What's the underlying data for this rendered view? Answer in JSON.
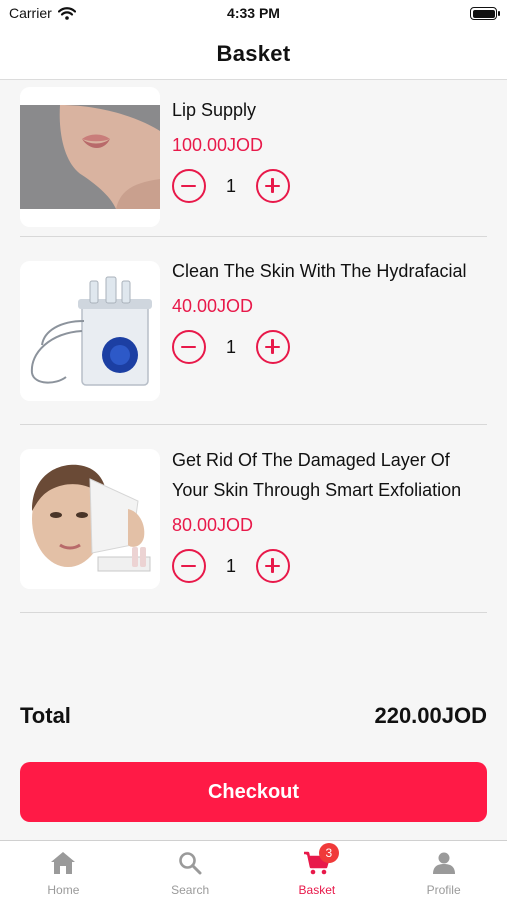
{
  "status_bar": {
    "carrier": "Carrier",
    "time": "4:33 PM"
  },
  "header": {
    "title": "Basket"
  },
  "items": [
    {
      "name": "Lip Supply",
      "price": "100.00JOD",
      "quantity": "1",
      "image_icon": "lips-photo"
    },
    {
      "name": "Clean The Skin With The Hydrafacial",
      "price": "40.00JOD",
      "quantity": "1",
      "image_icon": "hydrafacial-machine-photo"
    },
    {
      "name": "Get Rid Of The Damaged Layer Of Your Skin Through Smart Exfoliation",
      "price": "80.00JOD",
      "quantity": "1",
      "image_icon": "face-peel-photo"
    }
  ],
  "summary": {
    "total_label": "Total",
    "total_value": "220.00JOD"
  },
  "checkout_label": "Checkout",
  "tabs": [
    {
      "label": "Home",
      "icon": "home-icon"
    },
    {
      "label": "Search",
      "icon": "search-icon"
    },
    {
      "label": "Basket",
      "icon": "cart-icon",
      "badge": "3",
      "active": true
    },
    {
      "label": "Profile",
      "icon": "person-icon"
    }
  ],
  "colors": {
    "accent": "#e8194a",
    "button": "#ff1a46",
    "badge": "#f03a3a"
  }
}
